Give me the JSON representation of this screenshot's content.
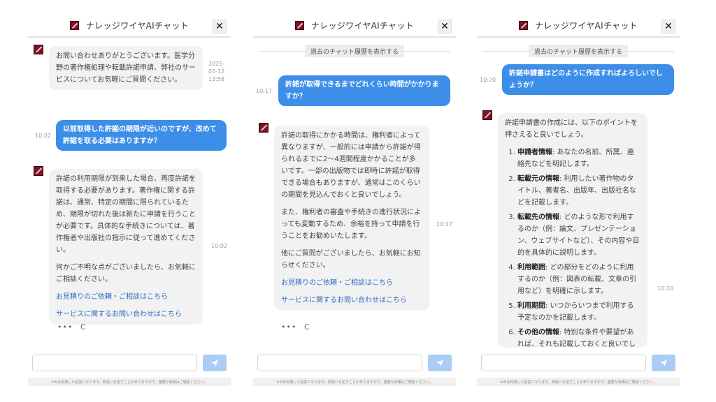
{
  "app": {
    "title": "ナレッジワイヤAIチャット",
    "close_label": "✕"
  },
  "history_button": "過去のチャット履歴を表示する",
  "disclaimer": "※AIを利用した回答になります。間違いを犯すことがありますので、重要な情報はご確認ください。",
  "actions": {
    "more": "•••",
    "retry": "C"
  },
  "panel1": {
    "greeting": "お問い合わせありがとうございます。医学分野の著作権処理や転載許諾申請、弊社のサービスについてお気軽にご質問ください。",
    "greeting_time": "2025-05-12 13:58",
    "user_message": "以前取得した許諾の期限が近いのですが、改めて許諾を取る必要はありますか？",
    "user_time": "10:02",
    "bot_paragraphs": [
      "許諾の利用期限が到来した場合、再度許諾を取得する必要があります。著作権に関する許諾は、通常、特定の期間に限られているため、期限が切れた後は新たに申請を行うことが必要です。具体的な手続きについては、著作権者や出版社の指示に従って進めてください。",
      "何かご不明な点がございましたら、お気軽にご相談ください。"
    ],
    "links": [
      "お見積りのご依頼・ご相談はこちら",
      "サービスに関するお問い合わせはこちら"
    ],
    "bot_time": "10:02"
  },
  "panel2": {
    "user_message": "許諾が取得できるまでどれくらい時間がかかりますか？",
    "user_time": "10:17",
    "bot_paragraphs": [
      "許諾の取得にかかる時間は、権利者によって異なりますが、一般的には申請から許諾が得られるまでに2〜4週間程度かかることが多いです。一部の出版物では即時に許諾が取得できる場合もありますが、通常はこのくらいの期間を見込んでおくと良いでしょう。",
      "また、権利者の審査や手続きの進行状況によっても変動するため、余裕を持って申請を行うことをお勧めいたします。",
      "他にご質問がございましたら、お気軽にお知らせください。"
    ],
    "links": [
      "お見積りのご依頼・ご相談はこちら",
      "サービスに関するお問い合わせはこちら"
    ],
    "bot_time": "10:17"
  },
  "panel3": {
    "user_message": "許諾申請書はどのように作成すればよろしいでしょうか？",
    "user_time": "10:20",
    "intro": "許諾申請書の作成には、以下のポイントを押さえると良いでしょう。",
    "points": [
      {
        "label": "申請者情報",
        "text": ": あなたの名前、所属、連絡先などを明記します。"
      },
      {
        "label": "転載元の情報",
        "text": ": 利用したい著作物のタイトル、著者名、出版年、出版社名などを記載します。"
      },
      {
        "label": "転載先の情報",
        "text": ": どのような形で利用するのか（例：論文、プレゼンテーション、ウェブサイトなど）、その内容や目的を具体的に説明します。"
      },
      {
        "label": "利用範囲",
        "text": ": どの部分をどのように利用するのか（例：図表の転載、文章の引用など）を明確に示します。"
      },
      {
        "label": "利用期間",
        "text": ": いつからいつまで利用する予定なのかを記載します。"
      },
      {
        "label": "その他の情報",
        "text": ": 特別な条件や要望があれば、それも記載しておくと良いでしょう。"
      }
    ],
    "bot_time": "10:20"
  }
}
